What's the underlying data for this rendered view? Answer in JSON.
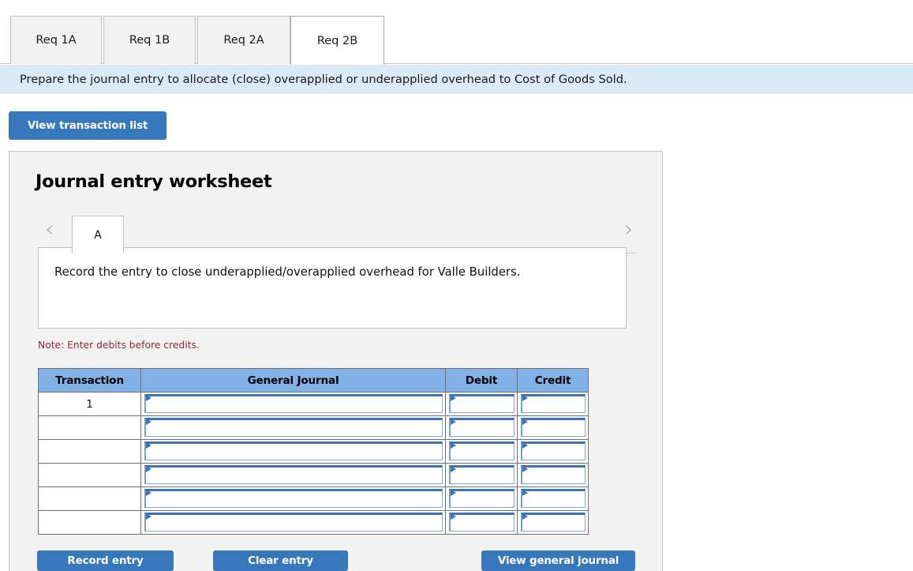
{
  "tabs": [
    {
      "label": "Req 1A",
      "active": false
    },
    {
      "label": "Req 1B",
      "active": false
    },
    {
      "label": "Req 2A",
      "active": false
    },
    {
      "label": "Req 2B",
      "active": true
    }
  ],
  "instruction": {
    "text": "Prepare the journal entry to allocate (close) overapplied or underapplied overhead to Cost of Goods Sold."
  },
  "toolbar": {
    "view_transaction_list_label": "View transaction list"
  },
  "worksheet": {
    "title": "Journal entry worksheet",
    "nav": {
      "prev_icon": "chevron-left-icon",
      "next_icon": "chevron-right-icon",
      "prev_glyph": "‹",
      "next_glyph": "›"
    },
    "entry_tabs": [
      {
        "label": "A",
        "active": true
      }
    ],
    "description": "Record the entry to close underapplied/overapplied overhead for Valle Builders.",
    "note": "Note: Enter debits before credits.",
    "table": {
      "columns": [
        "Transaction",
        "General Journal",
        "Debit",
        "Credit"
      ],
      "rows": [
        {
          "transaction": "1",
          "general_journal": "",
          "debit": "",
          "credit": ""
        },
        {
          "transaction": "",
          "general_journal": "",
          "debit": "",
          "credit": ""
        },
        {
          "transaction": "",
          "general_journal": "",
          "debit": "",
          "credit": ""
        },
        {
          "transaction": "",
          "general_journal": "",
          "debit": "",
          "credit": ""
        },
        {
          "transaction": "",
          "general_journal": "",
          "debit": "",
          "credit": ""
        },
        {
          "transaction": "",
          "general_journal": "",
          "debit": "",
          "credit": ""
        }
      ]
    },
    "footer": {
      "record_entry_label": "Record entry",
      "clear_entry_label": "Clear entry",
      "view_general_journal_label": "View general journal"
    }
  },
  "colors": {
    "accent_blue": "#3777bc",
    "instruction_bg": "#daeaf7",
    "table_header_blue": "#82b1e8",
    "note_red": "#9b2335",
    "panel_bg": "#f2f2f2"
  }
}
